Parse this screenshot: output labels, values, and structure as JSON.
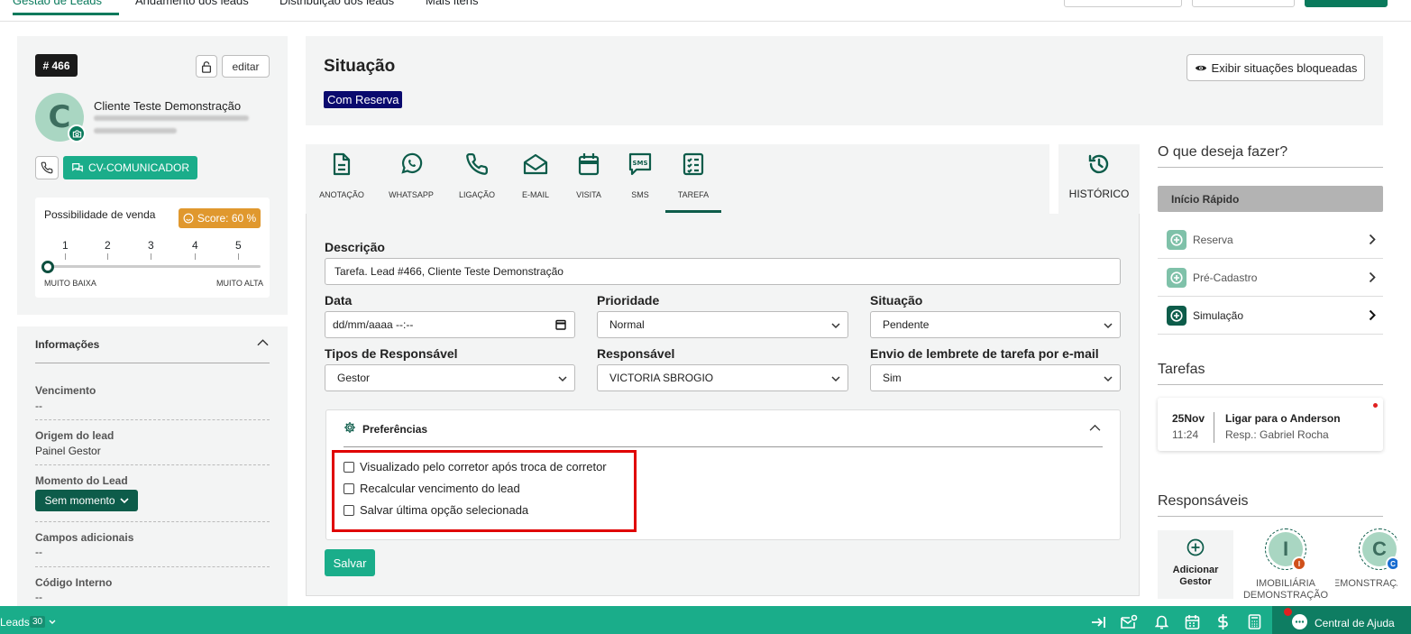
{
  "lead": {
    "id": "# 466",
    "edit_label": "editar",
    "name": "Cliente Teste Demonstração",
    "avatar_letter": "C",
    "communicator_label": "CV-COMUNICADOR"
  },
  "sale_chance": {
    "title": "Possibilidade de venda",
    "score_label": "Score: 60 %",
    "scale": [
      "1",
      "2",
      "3",
      "4",
      "5"
    ],
    "level": 0,
    "low_label": "MUITO BAIXA",
    "high_label": "MUITO ALTA"
  },
  "info": {
    "title": "Informações",
    "fields": [
      {
        "label": "Vencimento",
        "value": "--"
      },
      {
        "label": "Origem do lead",
        "value": "Painel Gestor"
      },
      {
        "label": "Momento do Lead",
        "value": "Sem momento"
      },
      {
        "label": "Campos adicionais",
        "value": "--"
      },
      {
        "label": "Código Interno",
        "value": "--"
      }
    ]
  },
  "situation": {
    "title": "Situação",
    "status": "Com Reserva",
    "blocked_button": "Exibir situações bloqueadas"
  },
  "tabs": [
    {
      "label": "ANOTAÇÃO",
      "icon": "document-icon"
    },
    {
      "label": "WHATSAPP",
      "icon": "whatsapp-icon"
    },
    {
      "label": "LIGAÇÃO",
      "icon": "phone-icon"
    },
    {
      "label": "E-MAIL",
      "icon": "envelope-icon"
    },
    {
      "label": "VISITA",
      "icon": "calendar-icon"
    },
    {
      "label": "SMS",
      "icon": "sms-icon"
    },
    {
      "label": "TAREFA",
      "icon": "checklist-icon",
      "active": true
    }
  ],
  "history_label": "HISTÓRICO",
  "form": {
    "description_label": "Descrição",
    "description_value": "Tarefa. Lead #466, Cliente Teste Demonstração",
    "date_label": "Data",
    "date_placeholder": "dd/mm/aaaa --:--",
    "priority_label": "Prioridade",
    "priority_value": "Normal",
    "status_label": "Situação",
    "status_value": "Pendente",
    "resp_type_label": "Tipos de Responsável",
    "resp_type_value": "Gestor",
    "resp_label": "Responsável",
    "resp_value": "VICTORIA SBROGIO",
    "reminder_label": "Envio de lembrete de tarefa por e-mail",
    "reminder_value": "Sim",
    "prefs_title": "Preferências",
    "prefs": [
      "Visualizado pelo corretor após troca de corretor",
      "Recalcular vencimento do lead",
      "Salvar última opção selecionada"
    ],
    "save_label": "Salvar",
    "highlight_color": "#e00000"
  },
  "right": {
    "question": "O que deseja fazer?",
    "quick_start": "Início Rápido",
    "actions": [
      "Reserva",
      "Pré-Cadastro",
      "Simulação"
    ],
    "tasks_title": "Tarefas",
    "task": {
      "day": "25Nov",
      "time": "11:24",
      "title": "Ligar para o Anderson",
      "resp": "Resp.: Gabriel Rocha"
    },
    "resp_title": "Responsáveis",
    "add_label": "Adicionar Gestor",
    "people": [
      {
        "letter": "I",
        "badge": "I",
        "name": "IMOBILIÁRIA DEMONSTRAÇÃO"
      },
      {
        "letter": "C",
        "badge": "C",
        "name": "CORRETOR DEMONSTRAÇÃO"
      }
    ]
  },
  "footer": {
    "leads_label": "Leads",
    "page_size": "30",
    "help_label": "Central de Ajuda"
  },
  "colors": {
    "brand": "#0a7a5c",
    "accent": "#1aad8a",
    "badge_navy": "#0a0a6e",
    "score": "#e0982e"
  }
}
